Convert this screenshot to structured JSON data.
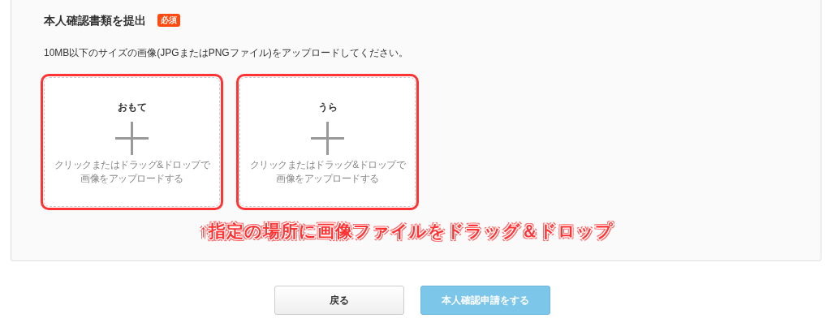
{
  "section": {
    "title": "本人確認書類を提出",
    "badge": "必須",
    "instruction": "10MB以下のサイズの画像(JPGまたはPNGファイル)をアップロードしてください。"
  },
  "uploads": [
    {
      "label": "おもて",
      "hint_line_1": "クリックまたはドラッグ&ドロップで",
      "hint_line_2": "画像をアップロードする"
    },
    {
      "label": "うら",
      "hint_line_1": "クリックまたはドラッグ&ドロップで",
      "hint_line_2": "画像をアップロードする"
    }
  ],
  "annotation": "↑指定の場所に画像ファイルをドラッグ＆ドロップ",
  "buttons": [
    {
      "kind": "secondary",
      "label": "戻る",
      "disabled": false
    },
    {
      "kind": "primary",
      "label": "本人確認申請をする",
      "disabled": true
    }
  ]
}
